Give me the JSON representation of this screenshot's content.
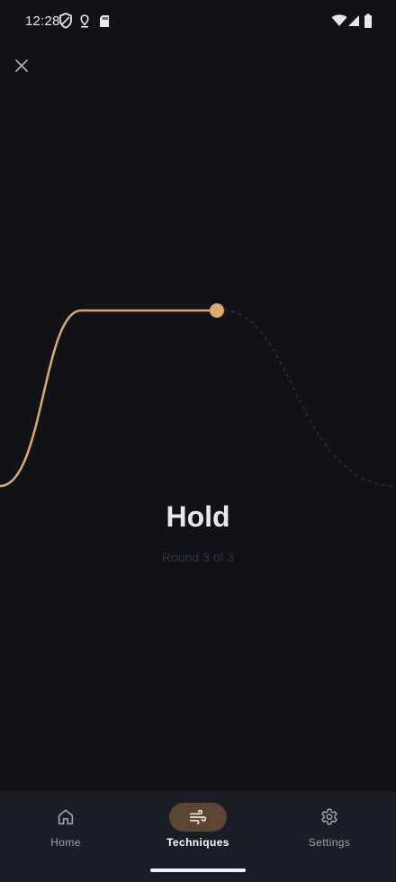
{
  "status_bar": {
    "time": "12:28",
    "icons": [
      "shield-icon",
      "location-pin-icon",
      "sd-card-icon",
      "wifi-icon",
      "cellular-signal-icon",
      "battery-icon"
    ]
  },
  "toolbar": {
    "close_icon": "close-icon"
  },
  "exercise": {
    "phase": "Hold",
    "round_text": "Round 3 of 3",
    "accent_color": "#e0aa6e",
    "upcoming_color": "#2a3140"
  },
  "nav": {
    "items": [
      {
        "label": "Home",
        "icon": "home-icon",
        "active": false
      },
      {
        "label": "Techniques",
        "icon": "wind-icon",
        "active": true
      },
      {
        "label": "Settings",
        "icon": "gear-icon",
        "active": false
      }
    ]
  }
}
